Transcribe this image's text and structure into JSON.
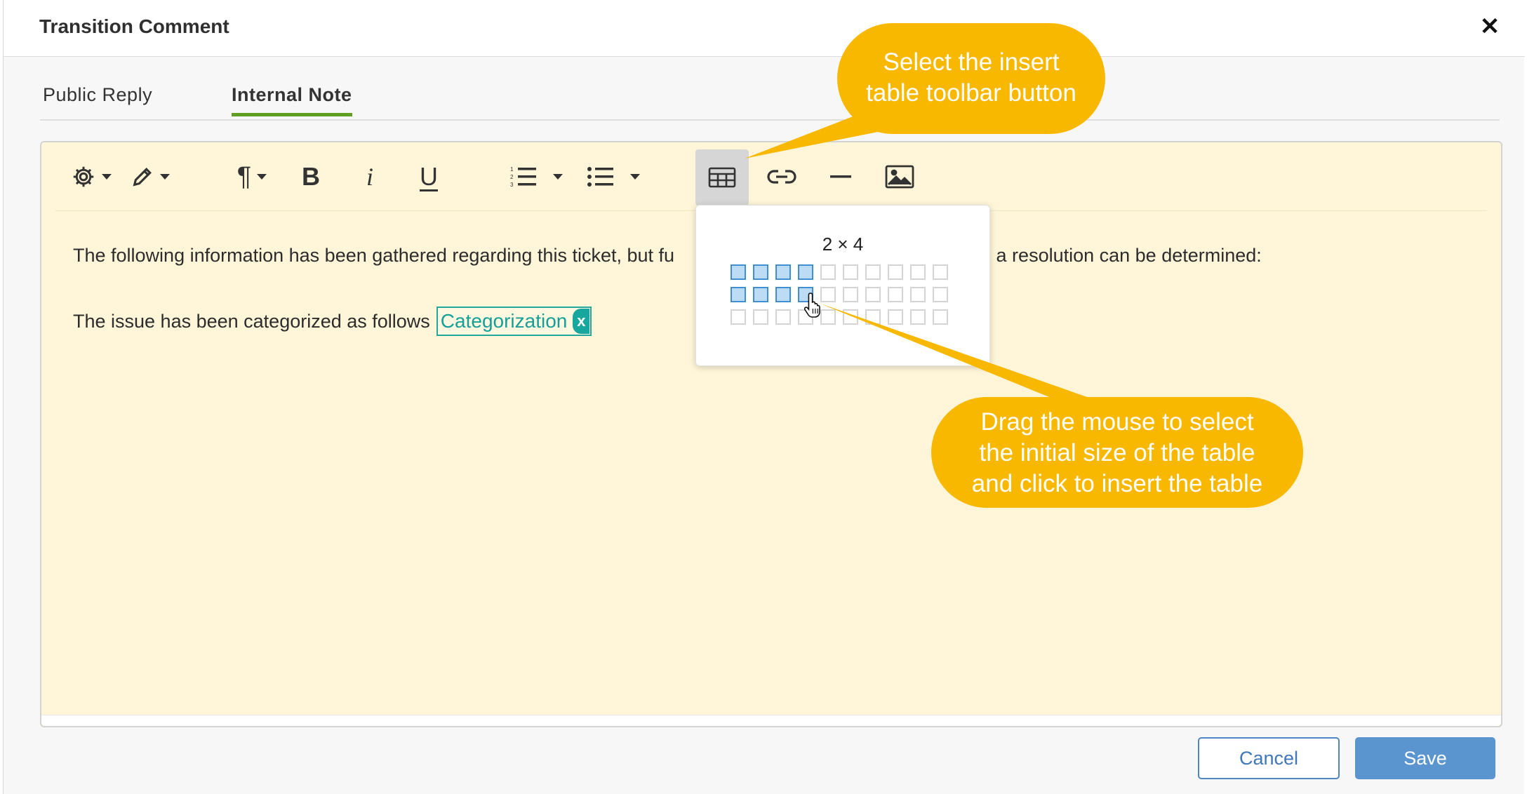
{
  "dialog": {
    "title": "Transition Comment",
    "close_label": "✕"
  },
  "tabs": [
    {
      "label": "Public Reply",
      "active": false
    },
    {
      "label": "Internal Note",
      "active": true
    }
  ],
  "toolbar": {
    "buttons": [
      {
        "icon": "gear-icon",
        "dropdown": true
      },
      {
        "icon": "pencil-icon",
        "dropdown": true
      },
      {
        "icon": "paragraph-icon",
        "dropdown": true
      },
      {
        "icon": "bold-icon",
        "glyph": "B"
      },
      {
        "icon": "italic-icon",
        "glyph": "i"
      },
      {
        "icon": "underline-icon",
        "glyph": "U"
      },
      {
        "icon": "ordered-list-icon",
        "dropdown": true
      },
      {
        "icon": "bullet-list-icon",
        "dropdown": true
      },
      {
        "icon": "table-icon",
        "active": true
      },
      {
        "icon": "link-icon"
      },
      {
        "icon": "horizontal-rule-icon"
      },
      {
        "icon": "image-icon"
      }
    ]
  },
  "content": {
    "line1_start": "The following information has been gathered regarding this ticket, but fu",
    "line1_end": "ore a resolution can be determined:",
    "line2": "The issue has been categorized as follows",
    "tag_label": "Categorization",
    "tag_remove": "x"
  },
  "table_picker": {
    "size_label": "2 × 4",
    "rows": 3,
    "cols": 10,
    "selected_rows": 2,
    "selected_cols": 4
  },
  "callouts": {
    "toolbar_hint": [
      "Select the insert",
      "table toolbar button"
    ],
    "drag_hint": [
      "Drag the mouse to select",
      "the initial size of the table",
      "and click to insert the table"
    ]
  },
  "footer": {
    "cancel_label": "Cancel",
    "save_label": "Save"
  },
  "colors": {
    "editor_bg": "#fff5d8",
    "callout": "#f9b800",
    "tab_active_underline": "#5e9f21",
    "primary_button": "#5b95cf",
    "tag_teal": "#17a79e"
  }
}
